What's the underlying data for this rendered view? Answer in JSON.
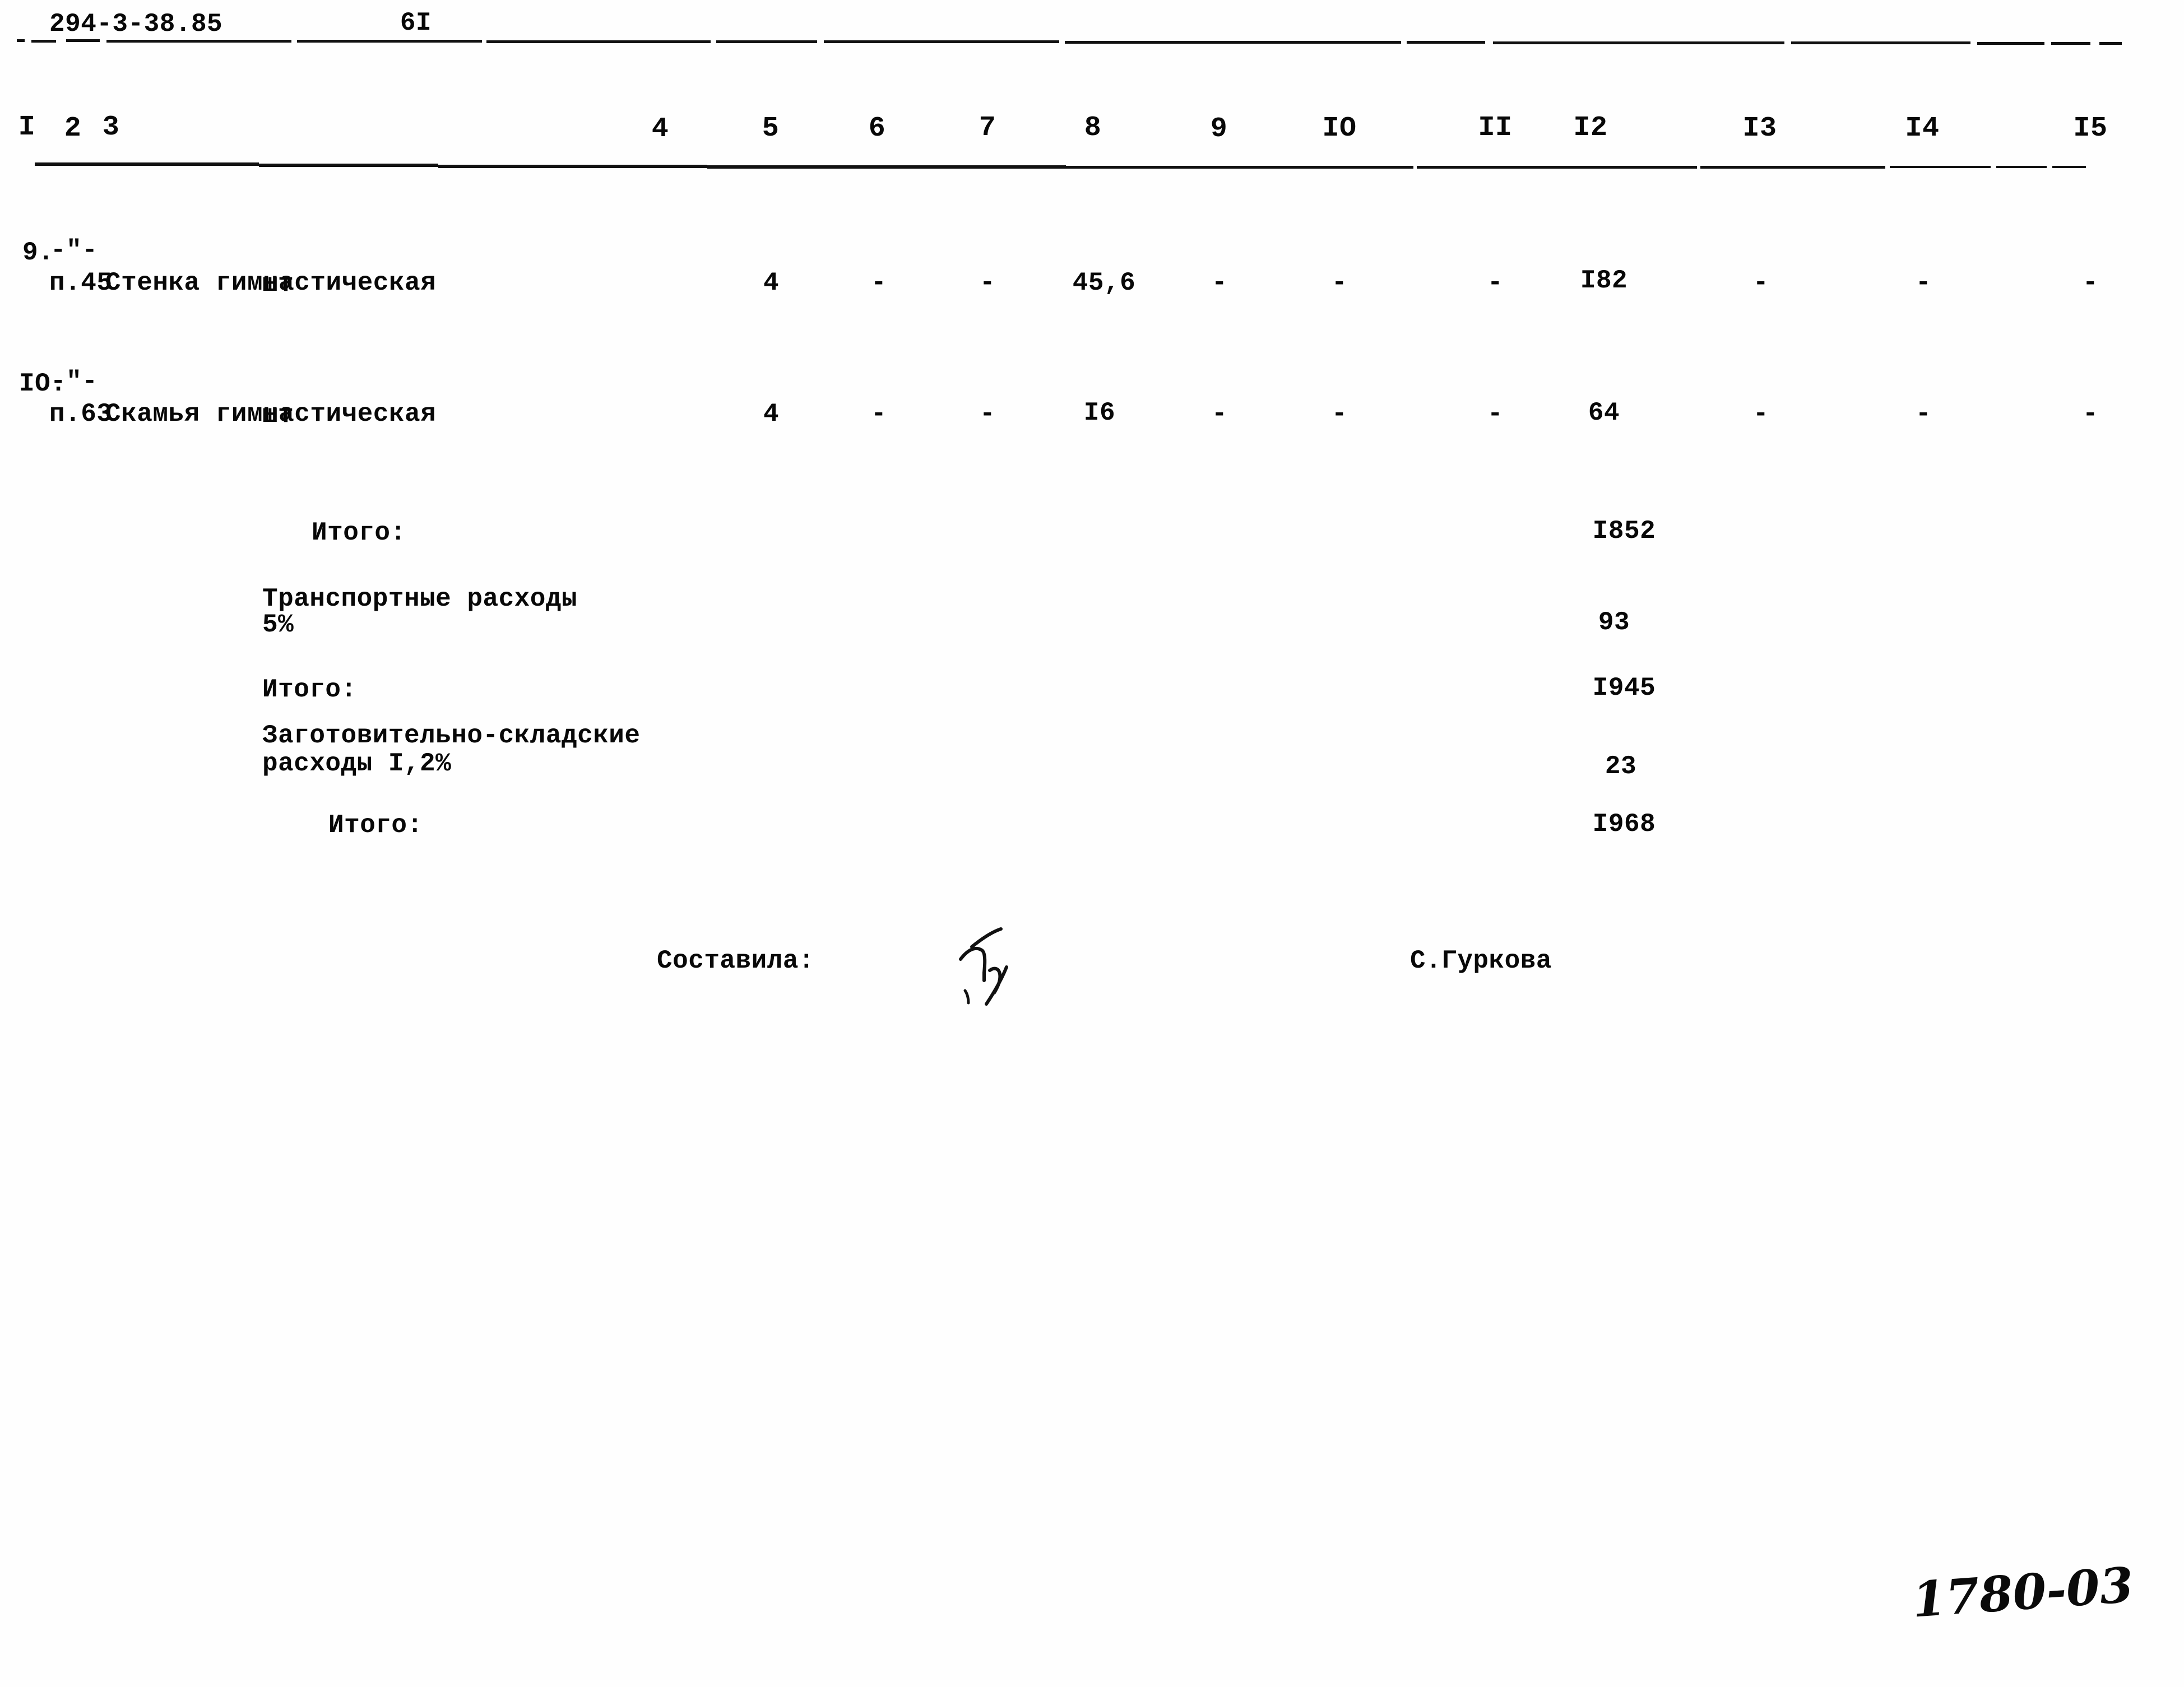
{
  "document": {
    "code": "294-3-38.85",
    "page_number": "6I",
    "archive_code": "1780-03"
  },
  "table": {
    "column_headers": [
      "I",
      "2",
      "3",
      "4",
      "5",
      "6",
      "7",
      "8",
      "9",
      "IO",
      "II",
      "I2",
      "I3",
      "I4",
      "I5"
    ],
    "rows": [
      {
        "num": "9.",
        "ref_top": "-\"-",
        "ref_bottom": "п.45",
        "name": "Стенка гимнастическая",
        "unit": "шт",
        "c5": "4",
        "c6": "-",
        "c7": "-",
        "c8": "45,6",
        "c9": "-",
        "c10": "-",
        "c11": "-",
        "c12": "I82",
        "c13": "-",
        "c14": "-",
        "c15": "-"
      },
      {
        "num": "IO.",
        "ref_top": "-\"-",
        "ref_bottom": "п.63",
        "name": "Скамья гимнастическая",
        "unit": "шт",
        "c5": "4",
        "c6": "-",
        "c7": "-",
        "c8": "I6",
        "c9": "-",
        "c10": "-",
        "c11": "-",
        "c12": "64",
        "c13": "-",
        "c14": "-",
        "c15": "-"
      }
    ]
  },
  "summary": {
    "total_1_label": "Итого:",
    "total_1_value": "I852",
    "transport_label": "Транспортные расходы",
    "transport_percent": "5%",
    "transport_value": "93",
    "total_2_label": "Итого:",
    "total_2_value": "I945",
    "procurement_label_line1": "Заготовительно-складские",
    "procurement_label_line2": "расходы I,2%",
    "procurement_value": "23",
    "total_3_label": "Итого:",
    "total_3_value": "I968"
  },
  "footer": {
    "compiled_by_label": "Составила:",
    "compiled_by_name": "С.Гуркова",
    "signature_glyph": "handwritten-signature"
  }
}
